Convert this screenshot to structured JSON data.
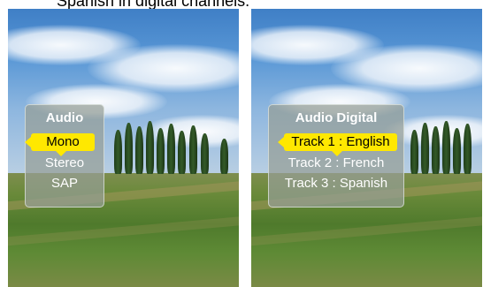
{
  "caption": "Spanish in digital channels.",
  "audio_menu": {
    "title": "Audio",
    "items": [
      "Mono",
      "Stereo",
      "SAP"
    ],
    "selected_index": 0
  },
  "digital_menu": {
    "title": "Audio Digital",
    "items": [
      "Track 1 : English",
      "Track 2 : French",
      "Track 3 : Spanish"
    ],
    "selected_index": 0
  },
  "colors": {
    "highlight": "#ffe800",
    "menu_text": "#ffffff",
    "selected_text": "#000000"
  }
}
